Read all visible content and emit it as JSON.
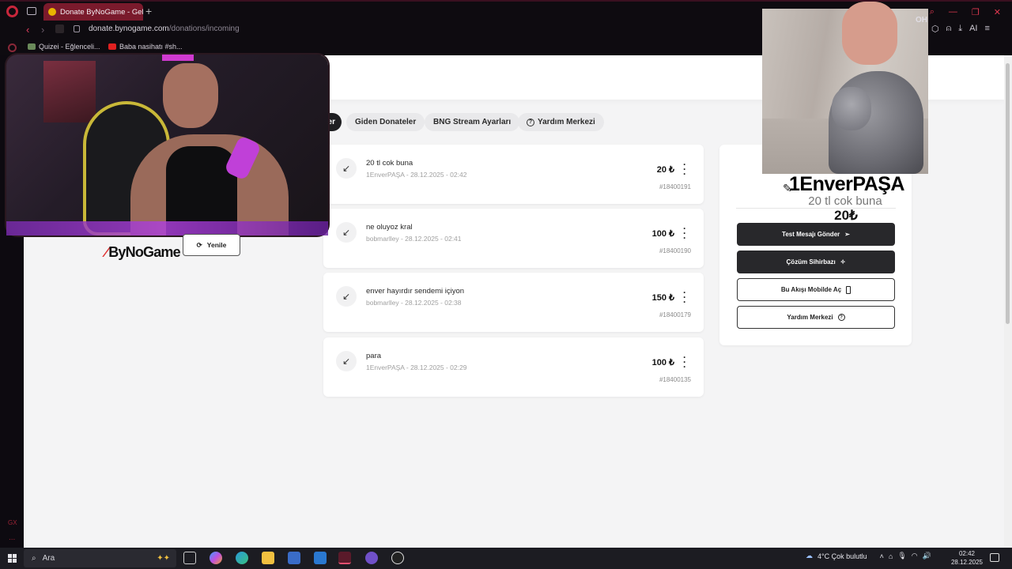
{
  "browser": {
    "tab_title": "Donate ByNoGame - Gelen",
    "new_tab": "+",
    "url_domain": "donate.bynogame.com",
    "url_path": "/donations/incoming",
    "bookmarks": [
      {
        "label": "Quizei - Eğlenceli..."
      },
      {
        "label": "Baba nasihatı #sh..."
      }
    ],
    "ai_label": "AI",
    "oh_label": "OH"
  },
  "nav": {
    "active_tab_fragment": "er",
    "tabs": [
      {
        "label": "Giden Donateler"
      },
      {
        "label": "BNG Stream Ayarları"
      },
      {
        "label": "Yardım Merkezi"
      }
    ]
  },
  "donations": [
    {
      "message": "20 tl cok buna",
      "user": "1EnverPAŞA",
      "time": "28.12.2025 - 02:42",
      "amount": "20 ₺",
      "id": "#18400191"
    },
    {
      "message": "ne oluyoz kral",
      "user": "bobmarlley",
      "time": "28.12.2025 - 02:41",
      "amount": "100 ₺",
      "id": "#18400190"
    },
    {
      "message": "enver hayırdır sendemi içiyon",
      "user": "bobmarlley",
      "time": "28.12.2025 - 02:38",
      "amount": "150 ₺",
      "id": "#18400179"
    },
    {
      "message": "para",
      "user": "1EnverPAŞA",
      "time": "28.12.2025 - 02:29",
      "amount": "100 ₺",
      "id": "#18400135"
    }
  ],
  "preview": {
    "user": "1EnverPAŞA",
    "message": "20 tl cok buna",
    "amount": "20₺"
  },
  "panel_buttons": [
    {
      "label": "Test Mesajı Gönder",
      "style": "dark",
      "icon": "send-icon"
    },
    {
      "label": "Çözüm Sihirbazı",
      "style": "dark",
      "icon": "magic-icon"
    },
    {
      "label": "Bu Akışı Mobilde Aç",
      "style": "light",
      "icon": "phone-icon"
    },
    {
      "label": "Yardım Merkezi",
      "style": "light",
      "icon": "help-icon"
    }
  ],
  "sidebar": {
    "logo": "ByNoGame",
    "refresh": "Yenile",
    "gx": "GX",
    "more": "..."
  },
  "taskbar": {
    "search_placeholder": "Ara",
    "weather": "4°C  Çok bulutlu",
    "time": "02:42",
    "date": "28.12.2025"
  },
  "colors": {
    "accent": "#c8263b",
    "tab_active": "#7a1a2c",
    "button_dark": "#28282b",
    "page_bg": "#f4f4f5"
  }
}
